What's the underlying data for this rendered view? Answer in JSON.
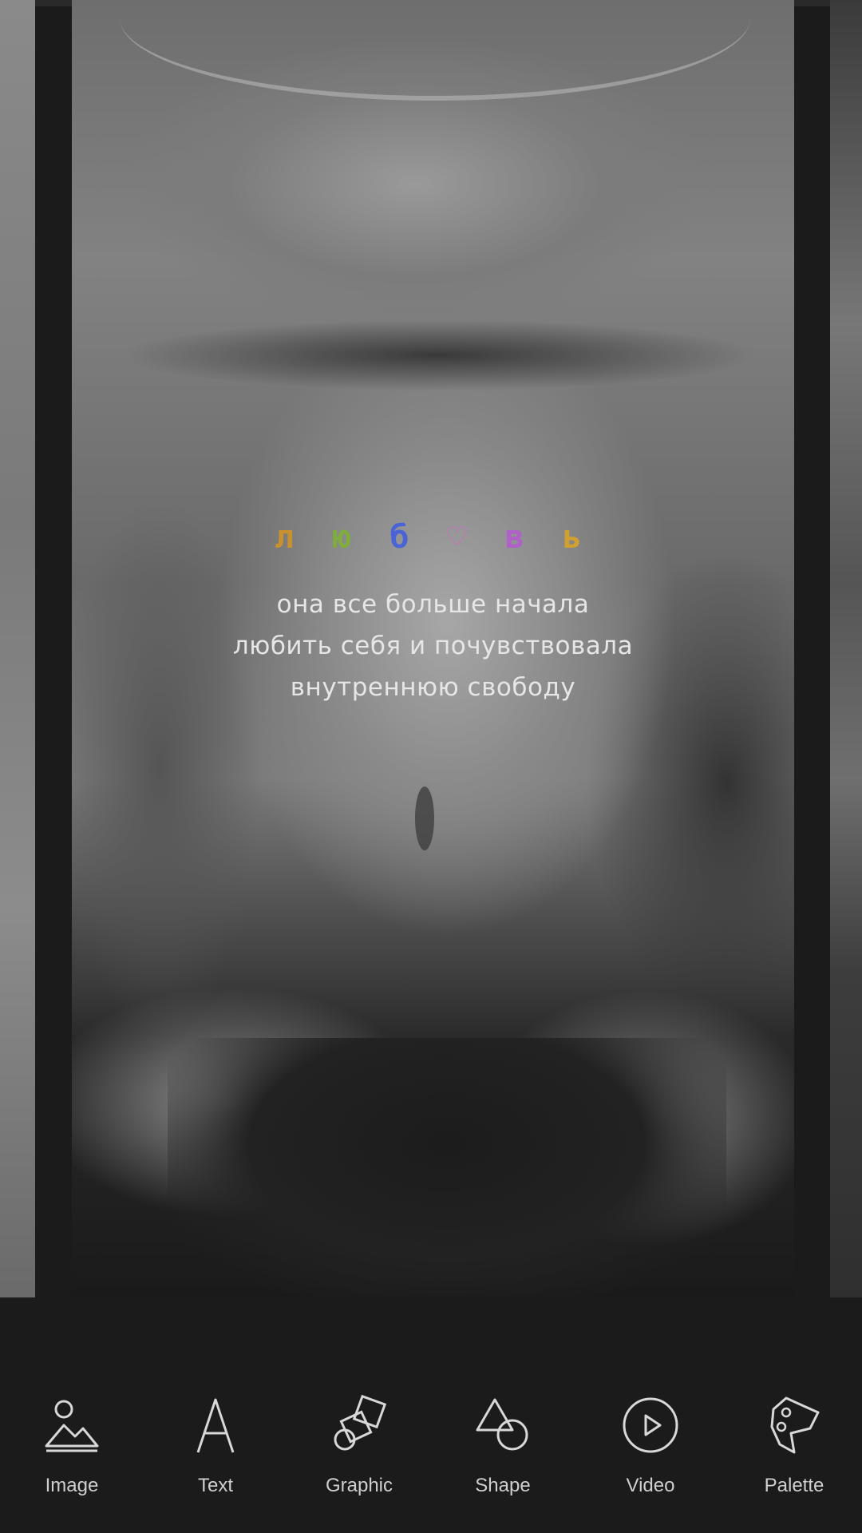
{
  "story": {
    "title_letters": [
      {
        "char": "л",
        "color": "#c9902f"
      },
      {
        "char": "ю",
        "color": "#7fae3c"
      },
      {
        "char": "б",
        "color": "#4a63d6"
      },
      {
        "char": "♡",
        "color": "#d06ac7"
      },
      {
        "char": "в",
        "color": "#b060c8"
      },
      {
        "char": "ь",
        "color": "#d0a030"
      }
    ],
    "caption_lines": [
      "она все больше начала",
      "любить себя и почувствовала",
      "внутреннюю свободу"
    ]
  },
  "toolbar": {
    "items": [
      {
        "label": "Image",
        "icon": "image-icon"
      },
      {
        "label": "Text",
        "icon": "text-icon"
      },
      {
        "label": "Graphic",
        "icon": "graphic-icon"
      },
      {
        "label": "Shape",
        "icon": "shape-icon"
      },
      {
        "label": "Video",
        "icon": "video-icon"
      },
      {
        "label": "Palette",
        "icon": "palette-icon"
      }
    ]
  }
}
